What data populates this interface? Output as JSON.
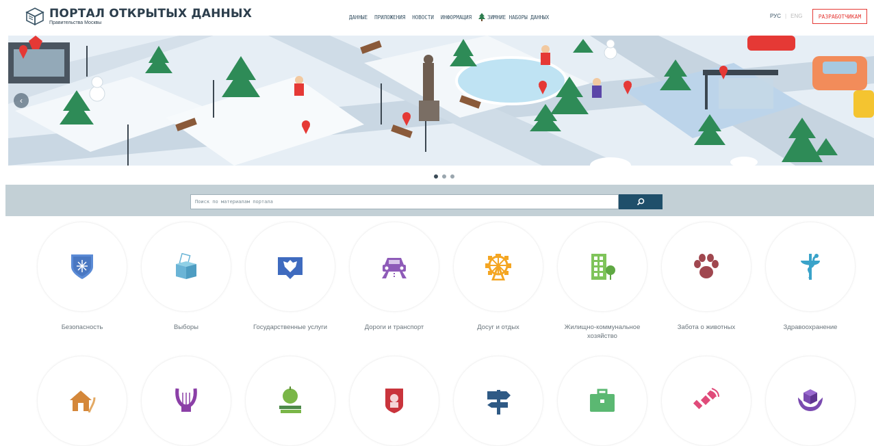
{
  "header": {
    "logo_title": "ПОРТАЛ ОТКРЫТЫХ ДАННЫХ",
    "logo_subtitle": "Правительства Москвы",
    "nav": [
      "ДАННЫЕ",
      "ПРИЛОЖЕНИЯ",
      "НОВОСТИ",
      "ИНФОРМАЦИЯ",
      "ЗИМНИЕ НАБОРЫ ДАННЫХ"
    ],
    "lang_ru": "РУС",
    "lang_sep": "|",
    "lang_en": "ENG",
    "developers_button": "РАЗРАБОТЧИКАМ"
  },
  "banner": {
    "arrow": "‹",
    "slides_total": 3,
    "active_slide": 1
  },
  "search": {
    "placeholder": "Поиск по материалам портала",
    "button_icon": "search-icon"
  },
  "categories_row1": [
    {
      "label": "Безопасность",
      "icon": "shield-icon",
      "color": "#5b8bd6"
    },
    {
      "label": "Выборы",
      "icon": "ballot-box-icon",
      "color": "#6ab4d6"
    },
    {
      "label": "Государственные услуги",
      "icon": "coat-of-arms-icon",
      "color": "#3f6bbf"
    },
    {
      "label": "Дороги и транспорт",
      "icon": "car-icon",
      "color": "#8e5bb8"
    },
    {
      "label": "Досуг и отдых",
      "icon": "ferris-wheel-icon",
      "color": "#f4a623"
    },
    {
      "label": "Жилищно-коммунальное хозяйство",
      "icon": "building-icon",
      "color": "#7fc45a"
    },
    {
      "label": "Забота о животных",
      "icon": "paw-icon",
      "color": "#a0474f"
    },
    {
      "label": "Здравоохранение",
      "icon": "medicine-icon",
      "color": "#3aa3c9"
    }
  ],
  "categories_row2": [
    {
      "icon": "house-icon",
      "color": "#d4873a"
    },
    {
      "icon": "lyre-icon",
      "color": "#8b3fa7"
    },
    {
      "icon": "apple-books-icon",
      "color": "#7ab648"
    },
    {
      "icon": "moscow-emblem-icon",
      "color": "#c9343c"
    },
    {
      "icon": "signpost-icon",
      "color": "#2f5a85"
    },
    {
      "icon": "briefcase-icon",
      "color": "#5bb872"
    },
    {
      "icon": "satellite-icon",
      "color": "#e04b7a"
    },
    {
      "icon": "hands-box-icon",
      "color": "#7a4ab0"
    }
  ]
}
